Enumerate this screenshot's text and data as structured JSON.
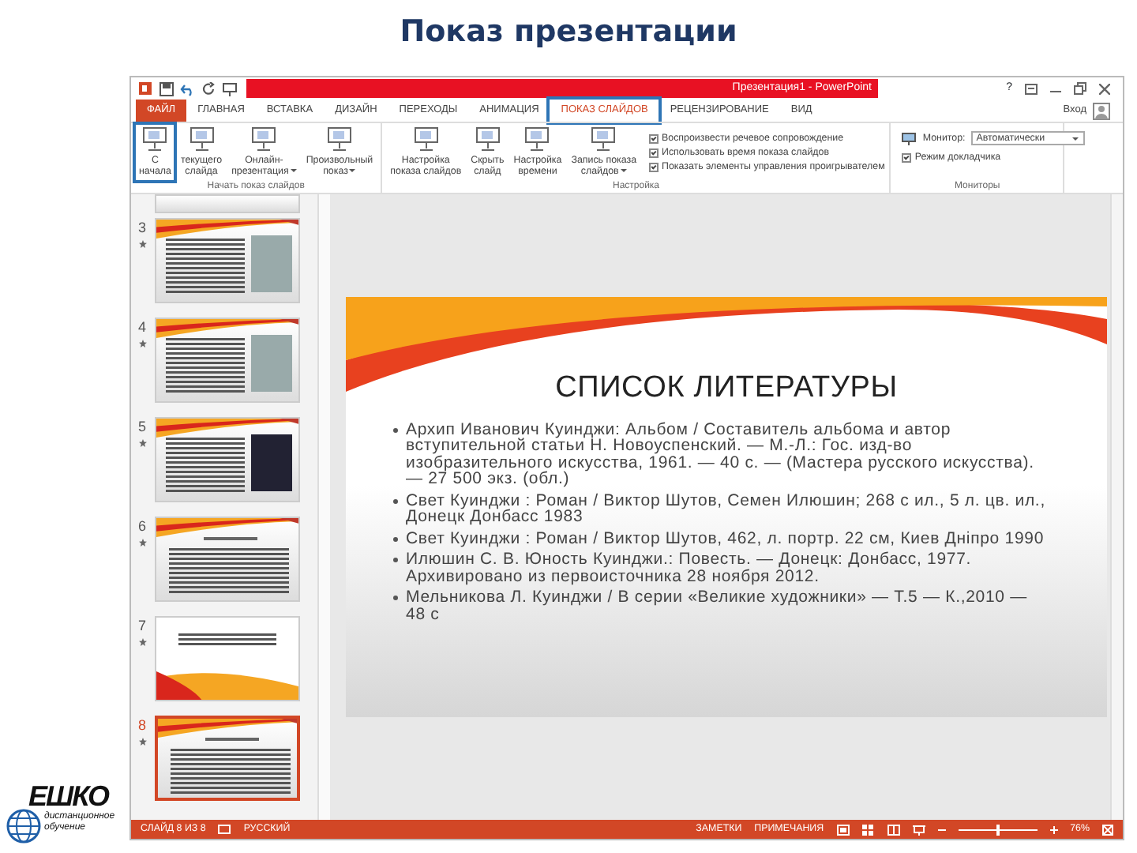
{
  "page_title": "Показ презентации",
  "window": {
    "title": "Презентация1 - PowerPoint",
    "help": "?",
    "sign_in": "Вход"
  },
  "tabs": [
    {
      "label": "ФАЙЛ",
      "kind": "file",
      "selected": false
    },
    {
      "label": "ГЛАВНАЯ",
      "kind": "tab",
      "selected": false
    },
    {
      "label": "ВСТАВКА",
      "kind": "tab",
      "selected": false
    },
    {
      "label": "ДИЗАЙН",
      "kind": "tab",
      "selected": false
    },
    {
      "label": "ПЕРЕХОДЫ",
      "kind": "tab",
      "selected": false
    },
    {
      "label": "АНИМАЦИЯ",
      "kind": "tab",
      "selected": false
    },
    {
      "label": "ПОКАЗ СЛАЙДОВ",
      "kind": "tab",
      "selected": true
    },
    {
      "label": "РЕЦЕНЗИРОВАНИЕ",
      "kind": "tab",
      "selected": false
    },
    {
      "label": "ВИД",
      "kind": "tab",
      "selected": false
    }
  ],
  "ribbon_groups": [
    {
      "label": "Начать показ слайдов",
      "buttons": [
        {
          "lines": [
            "С",
            "начала"
          ],
          "dropdown": false,
          "highlighted": true
        },
        {
          "lines": [
            "текущего",
            "слайда"
          ],
          "dropdown": false,
          "highlighted": false
        },
        {
          "lines": [
            "Онлайн-",
            "презентация"
          ],
          "dropdown": true,
          "highlighted": false
        },
        {
          "lines": [
            "Произвольный",
            "показ"
          ],
          "dropdown": true,
          "highlighted": false
        }
      ]
    },
    {
      "label": "Настройка",
      "buttons": [
        {
          "lines": [
            "Настройка",
            "показа слайдов"
          ],
          "dropdown": false,
          "highlighted": false
        },
        {
          "lines": [
            "Скрыть",
            "слайд"
          ],
          "dropdown": false,
          "highlighted": false
        },
        {
          "lines": [
            "Настройка",
            "времени"
          ],
          "dropdown": false,
          "highlighted": false
        },
        {
          "lines": [
            "Запись показа",
            "слайдов"
          ],
          "dropdown": true,
          "highlighted": false
        }
      ],
      "options": [
        {
          "label": "Воспроизвести речевое сопровождение",
          "checked": true
        },
        {
          "label": "Использовать время показа слайдов",
          "checked": true
        },
        {
          "label": "Показать элементы управления проигрывателем",
          "checked": true
        }
      ]
    },
    {
      "label": "Мониторы",
      "monitor_label": "Монитор:",
      "monitor_value": "Автоматически",
      "options": [
        {
          "label": "Режим докладчика",
          "checked": true
        }
      ]
    }
  ],
  "thumbnails": [
    {
      "number": "3",
      "kind": "text-photo",
      "selected": false
    },
    {
      "number": "4",
      "kind": "text-photo",
      "selected": false
    },
    {
      "number": "5",
      "kind": "text-photo",
      "selected": false
    },
    {
      "number": "6",
      "kind": "text",
      "selected": false
    },
    {
      "number": "7",
      "kind": "quote",
      "selected": false
    },
    {
      "number": "8",
      "kind": "text",
      "selected": true
    }
  ],
  "slide": {
    "title": "СПИСОК ЛИТЕРАТУРЫ",
    "bullets": [
      "Архип Иванович Куинджи: Альбом / Составитель альбома и автор вступительной статьи Н. Новоуспенский. — М.-Л.: Гос. изд-во изобразительного искусства, 1961. — 40 с. — (Мастера русского искусства). — 27 500 экз. (обл.)",
      "Свет Куинджи : Роман / Виктор Шутов, Семен Илюшин; 268 с ил., 5 л. цв. ил., Донецк Донбасс 1983",
      "Свет Куинджи : Роман / Виктор Шутов, 462, л. портр. 22 см, Киев Дніпро 1990",
      "Илюшин С. В. Юность Куинджи.: Повесть. — Донецк: Донбасс, 1977. Архивировано из первоисточника 28 ноября 2012.",
      "Мельникова Л. Куинджи / В серии «Великие художники» — Т.5 — К.,2010 — 48 с"
    ]
  },
  "status_bar": {
    "slide_info": "СЛАЙД 8 ИЗ 8",
    "language": "РУССКИЙ",
    "notes": "ЗАМЕТКИ",
    "comments": "ПРИМЕЧАНИЯ",
    "zoom": "76%",
    "zoom_slider": {
      "level": 0.5
    }
  },
  "logo": {
    "name": "ЕШКО",
    "tagline": "дистанционное обучение"
  }
}
